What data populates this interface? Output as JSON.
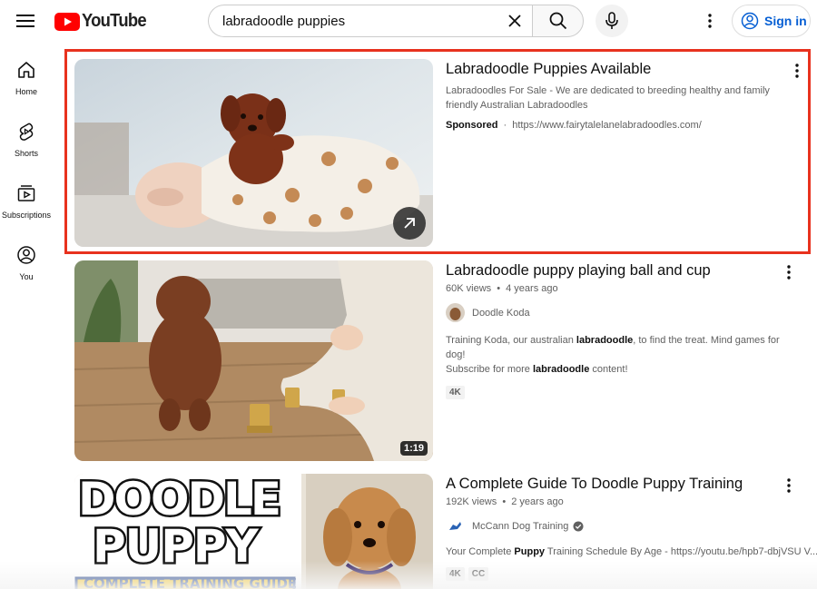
{
  "header": {
    "logo_text": "YouTube",
    "search_value": "labradoodle puppies",
    "signin_label": "Sign in",
    "brand_color": "#ff0000",
    "link_color": "#065fd4"
  },
  "sidebar": {
    "items": [
      {
        "label": "Home",
        "icon": "home-icon"
      },
      {
        "label": "Shorts",
        "icon": "shorts-icon"
      },
      {
        "label": "Subscriptions",
        "icon": "subscriptions-icon"
      },
      {
        "label": "You",
        "icon": "user-icon"
      }
    ]
  },
  "results": [
    {
      "title": "Labradoodle Puppies Available",
      "desc_line1": "Labradoodles For Sale - We are dedicated to breeding healthy and family",
      "desc_line2": "friendly Australian Labradoodles",
      "sponsored_label": "Sponsored",
      "separator": "·",
      "url": "https://www.fairytalelanelabradoodles.com/",
      "highlight_color": "#e8321e"
    },
    {
      "title": "Labradoodle puppy playing ball and cup",
      "views": "60K views",
      "age": "4 years ago",
      "separator": "•",
      "channel": "Doodle Koda",
      "desc1_a": "Training Koda, our australian ",
      "desc1_b": "labradoodle",
      "desc1_c": ", to find the treat. Mind games for dog!",
      "desc2_a": "Subscribe for more ",
      "desc2_b": "labradoodle",
      "desc2_c": " content!",
      "badges": [
        "4K"
      ],
      "duration": "1:19"
    },
    {
      "title": "A Complete Guide To Doodle Puppy Training",
      "views": "192K views",
      "age": "2 years ago",
      "separator": "•",
      "channel": "McCann Dog Training",
      "desc_a": "Your Complete ",
      "desc_b": "Puppy",
      "desc_c": " Training Schedule By Age - https://youtu.be/hpb7-dbjVSU V...",
      "badges": [
        "4K",
        "CC"
      ],
      "thumb_line1": "DOODLE",
      "thumb_line2": "PUPPY",
      "thumb_line3": "COMPLETE TRAINING GUIDE"
    }
  ]
}
